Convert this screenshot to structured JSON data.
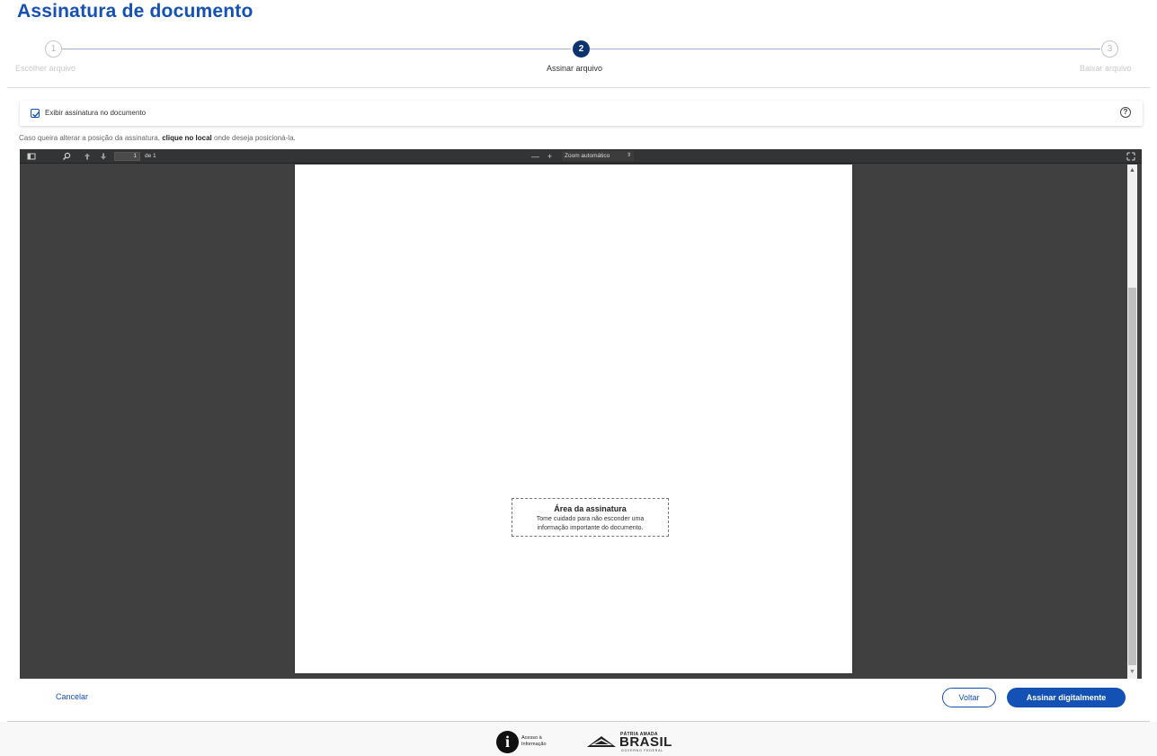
{
  "header": {
    "title": "Assinatura de documento"
  },
  "stepper": {
    "steps": [
      {
        "number": "1",
        "label": "Escolher arquivo",
        "state": "inactive"
      },
      {
        "number": "2",
        "label": "Assinar arquivo",
        "state": "active"
      },
      {
        "number": "3",
        "label": "Baixar arquivo",
        "state": "inactive"
      }
    ]
  },
  "options": {
    "show_signature_label": "Exibir assinatura no documento",
    "show_signature_checked": true,
    "help_icon": "help-circle-icon"
  },
  "hint": {
    "prefix": "Caso queira alterar a posição da assinatura, ",
    "bold": "clique no local",
    "suffix": " onde deseja posicioná-la."
  },
  "viewer": {
    "page_number": "1",
    "page_of": "de 1",
    "zoom_minus": "—",
    "zoom_plus": "+",
    "zoom_value": "Zoom automático",
    "icons": [
      "sidebar-toggle-icon",
      "search-icon",
      "previous-page-icon",
      "next-page-icon",
      "zoom-out-icon",
      "zoom-in-icon",
      "fullscreen-icon"
    ]
  },
  "signature_area": {
    "title": "Área da assinatura",
    "line1": "Tome cuidado para não esconder uma",
    "line2": "informação importante do documento."
  },
  "actions": {
    "cancel": "Cancelar",
    "back": "Voltar",
    "sign": "Assinar digitalmente"
  },
  "footer": {
    "acesso_line1": "Acesso à",
    "acesso_line2": "Informação",
    "brasil_top": "PÁTRIA AMADA",
    "brasil_main": "BRASIL",
    "brasil_sub": "GOVERNO FEDERAL"
  },
  "colors": {
    "primary": "#1351b4",
    "step_active": "#0c326f",
    "viewer_bg": "#404040",
    "toolbar_bg": "#333436"
  }
}
